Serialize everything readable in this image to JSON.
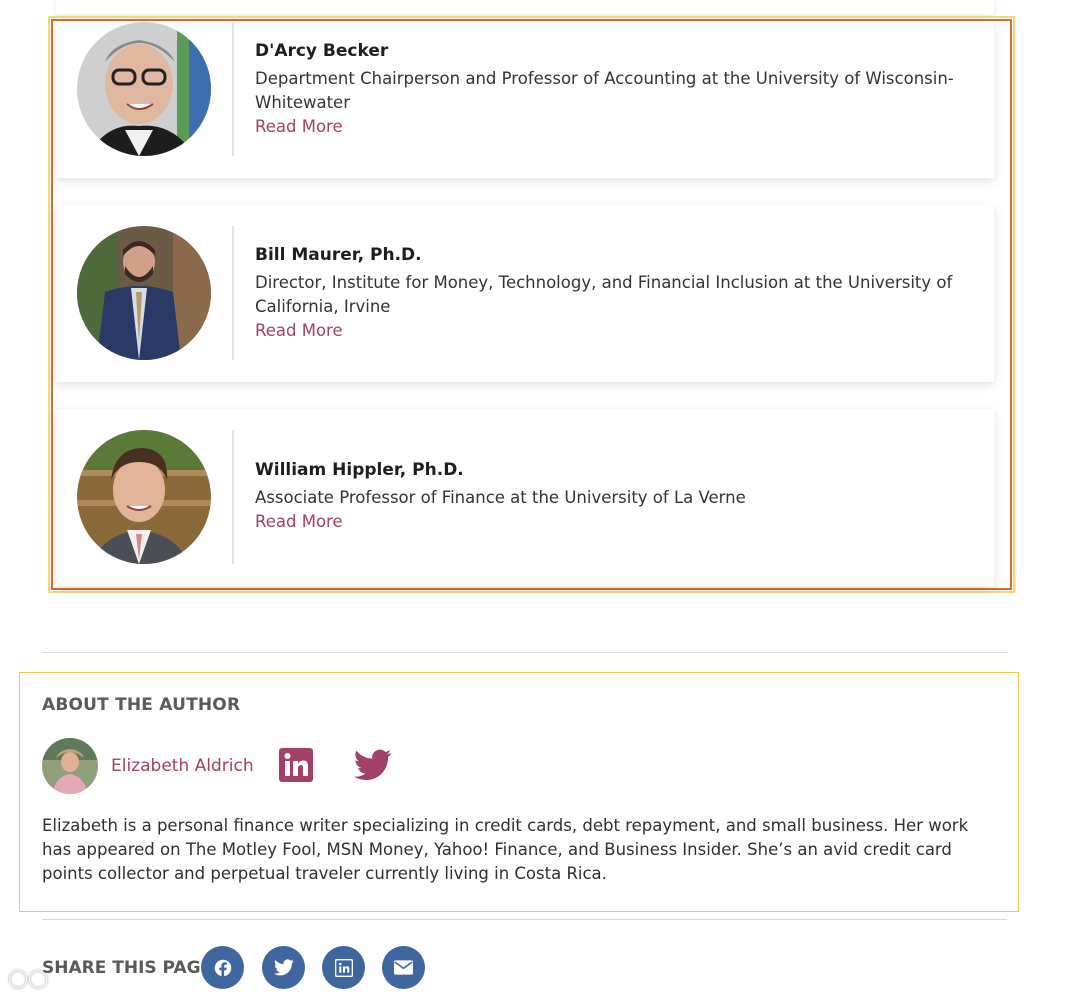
{
  "experts": [
    {
      "name": "D'Arcy Becker",
      "title": "Department Chairperson and Professor of Accounting at the University of Wisconsin-Whitewater",
      "link": "Read More"
    },
    {
      "name": "Bill Maurer, Ph.D.",
      "title": "Director, Institute for Money, Technology, and Financial Inclusion at the University of California, Irvine",
      "link": "Read More"
    },
    {
      "name": "William Hippler, Ph.D.",
      "title": "Associate Professor of Finance at the University of La Verne",
      "link": "Read More"
    }
  ],
  "author": {
    "heading": "ABOUT THE AUTHOR",
    "name": "Elizabeth Aldrich",
    "bio": "Elizabeth is a personal finance writer specializing in credit cards, debt repayment, and small business. Her work has appeared on The Motley Fool, MSN Money, Yahoo! Finance, and Business Insider. She’s an avid credit card points collector and perpetual traveler currently living in Costa Rica.",
    "social_icons": [
      "linkedin-icon",
      "twitter-icon"
    ]
  },
  "share": {
    "label": "SHARE THIS PAGE",
    "buttons": [
      "facebook-icon",
      "twitter-icon",
      "linkedin-icon",
      "email-icon"
    ]
  },
  "colors": {
    "accent": "#a2406a",
    "share_button": "#3e679f",
    "highlight_border": "#e16a2a",
    "author_border": "#f2c94c"
  }
}
